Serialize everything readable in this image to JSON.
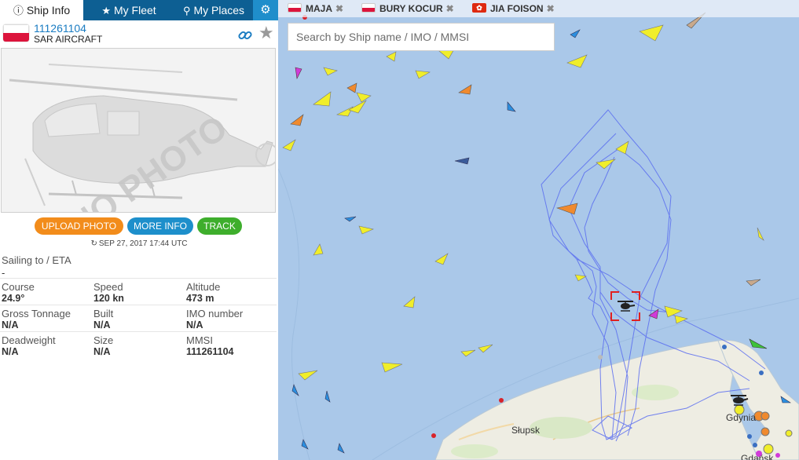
{
  "tabs": {
    "ship_info": "Ship Info",
    "my_fleet": "My Fleet",
    "my_places": "My Places",
    "settings_icon": "gear-icon"
  },
  "vessel": {
    "id": "111261104",
    "type": "SAR AIRCRAFT",
    "flag": "poland-flag",
    "photo_watermark": "NO PHOTO"
  },
  "actions": {
    "upload_photo": "UPLOAD PHOTO",
    "more_info": "MORE INFO",
    "track": "TRACK"
  },
  "timestamp": "SEP 27, 2017 17:44 UTC",
  "sailing": {
    "label": "Sailing to / ETA",
    "value": "-"
  },
  "details": [
    [
      {
        "label": "Course",
        "value": "24.9°"
      },
      {
        "label": "Speed",
        "value": "120 kn"
      },
      {
        "label": "Altitude",
        "value": "473 m"
      }
    ],
    [
      {
        "label": "Gross Tonnage",
        "value": "N/A"
      },
      {
        "label": "Built",
        "value": "N/A"
      },
      {
        "label": "IMO number",
        "value": "N/A"
      }
    ],
    [
      {
        "label": "Deadweight",
        "value": "N/A"
      },
      {
        "label": "Size",
        "value": "N/A"
      },
      {
        "label": "MMSI",
        "value": "111261104"
      }
    ]
  ],
  "pinned_vessels": [
    {
      "name": "MAJA",
      "flag": "poland-flag"
    },
    {
      "name": "BURY KOCUR",
      "flag": "poland-flag"
    },
    {
      "name": "JIA FOISON",
      "flag": "hong-kong-flag"
    }
  ],
  "search": {
    "placeholder": "Search by Ship name / IMO / MMSI"
  },
  "map": {
    "places": [
      "Słupsk",
      "Gdynia",
      "Gdańsk"
    ],
    "colors": {
      "sea": "#aac8e9",
      "land": "#eeede2",
      "track": "#5b6ef0",
      "cargo": "#f0ee2a",
      "tanker": "#f08a2e",
      "passenger": "#2b8fe0",
      "fishing": "#d03bd8",
      "tug": "#3ec23a",
      "selection": "#e02020"
    }
  }
}
